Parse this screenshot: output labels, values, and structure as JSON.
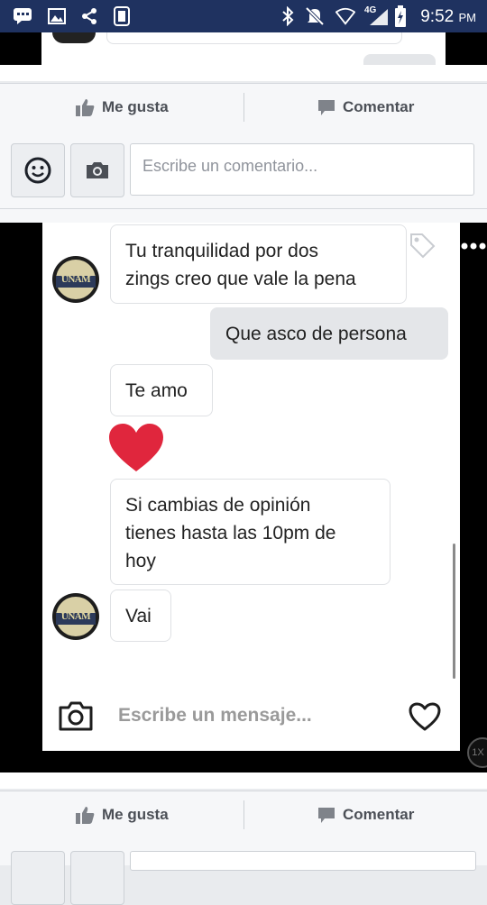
{
  "status_bar": {
    "time": "9:52",
    "ampm": "PM",
    "network": "4G",
    "left_icons": [
      "messenger-icon",
      "image-icon",
      "share-icon",
      "vibrate-icon"
    ],
    "right_icons": [
      "bluetooth-icon",
      "mute-icon",
      "wifi-icon",
      "signal-icon",
      "battery-charging-icon"
    ]
  },
  "post_actions": {
    "like_label": "Me gusta",
    "comment_label": "Comentar"
  },
  "comment_box": {
    "placeholder": "Escribe un comentario..."
  },
  "chat": {
    "messages": [
      {
        "from": "them",
        "text_lines": [
          "Tu tranquilidad por dos",
          "zings creo que vale la pena"
        ]
      },
      {
        "from": "me",
        "text_lines": [
          "Que asco de persona"
        ]
      },
      {
        "from": "them",
        "text_lines": [
          "Te amo"
        ]
      },
      {
        "from": "them",
        "type": "heart-sticker"
      },
      {
        "from": "them",
        "text_lines": [
          "Si cambias de opinión",
          "tienes hasta las 10pm de",
          "hoy"
        ]
      },
      {
        "from": "them",
        "text_lines": [
          "Vai"
        ]
      }
    ],
    "avatar_text": "UNAM",
    "input_placeholder": "Escribe un mensaje...",
    "speed_badge": "1X"
  },
  "colors": {
    "status_bar": "#1f3260",
    "fb_gray": "#4b4f56",
    "heart": "#e0263d"
  }
}
